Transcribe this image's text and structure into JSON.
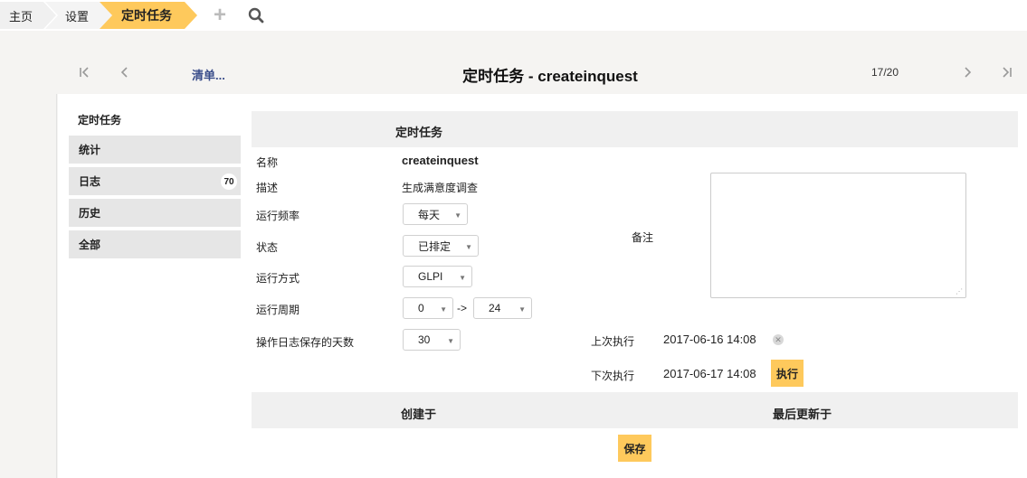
{
  "breadcrumb": {
    "home": "主页",
    "settings": "设置",
    "current": "定时任务"
  },
  "nav": {
    "list_link": "清单...",
    "title": "定时任务 - createinquest",
    "counter": "17/20"
  },
  "tabs": {
    "title": "定时任务",
    "items": [
      {
        "label": "统计"
      },
      {
        "label": "日志",
        "badge": "70"
      },
      {
        "label": "历史"
      },
      {
        "label": "全部"
      }
    ]
  },
  "form": {
    "section_title": "定时任务",
    "name_label": "名称",
    "name_value": "createinquest",
    "desc_label": "描述",
    "desc_value": "生成满意度调查",
    "freq_label": "运行频率",
    "freq_value": "每天",
    "status_label": "状态",
    "status_value": "已排定",
    "mode_label": "运行方式",
    "mode_value": "GLPI",
    "period_label": "运行周期",
    "period_from": "0",
    "period_arrow": "->",
    "period_to": "24",
    "logdays_label": "操作日志保存的天数",
    "logdays_value": "30",
    "notes_label": "备注",
    "last_run_label": "上次执行",
    "last_run_value": "2017-06-16 14:08",
    "next_run_label": "下次执行",
    "next_run_value": "2017-06-17 14:08",
    "execute_label": "执行",
    "created_label": "创建于",
    "updated_label": "最后更新于",
    "save_label": "保存"
  },
  "colors": {
    "accent": "#fec95c",
    "link": "#3a4d8a",
    "tab_bg": "#e6e6e6",
    "header_bg": "#f0f0f0"
  }
}
